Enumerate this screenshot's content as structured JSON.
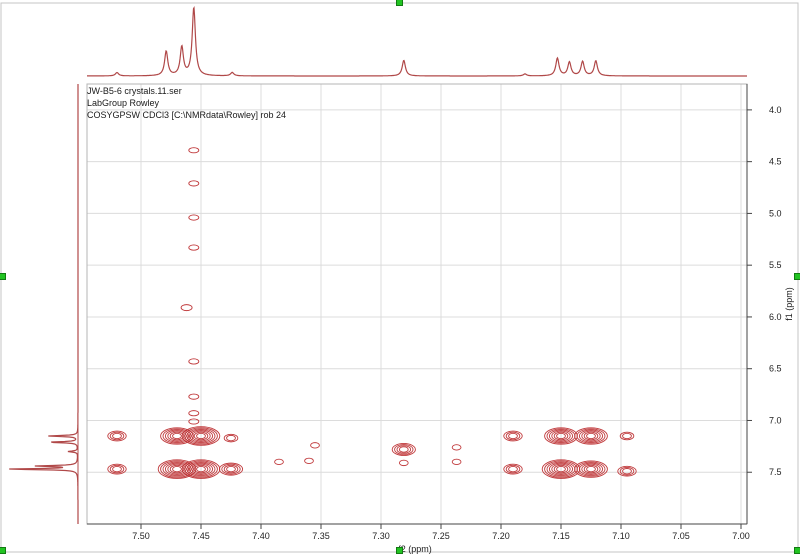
{
  "header": {
    "filename": "JW-B5-6 crystals.11.ser",
    "group": "LabGroup Rowley",
    "experiment": "COSYGPSW CDCl3 [C:\\NMRdata\\Rowley] rob 24"
  },
  "colors": {
    "contour": "#c0393b",
    "trace": "#b04848",
    "grid": "#dcdcdc",
    "axis": "#444444",
    "handle": "#22c322"
  },
  "chart_data": {
    "type": "contour",
    "xlabel": "f2 (ppm)",
    "ylabel": "f1 (ppm)",
    "xlim": [
      7.545,
      6.995
    ],
    "ylim": [
      3.75,
      8.0
    ],
    "x_reversed": true,
    "y_reversed": true,
    "grid": true,
    "x_ticks": [
      "7.50",
      "7.45",
      "7.40",
      "7.35",
      "7.30",
      "7.25",
      "7.20",
      "7.15",
      "7.10",
      "7.05",
      "7.00"
    ],
    "y_ticks": [
      "4.0",
      "4.5",
      "5.0",
      "5.5",
      "6.0",
      "6.5",
      "7.0",
      "7.5"
    ],
    "projection_f2_peaks": [
      {
        "ppm": 7.52,
        "intensity": 0.05
      },
      {
        "ppm": 7.479,
        "intensity": 0.36
      },
      {
        "ppm": 7.466,
        "intensity": 0.42
      },
      {
        "ppm": 7.456,
        "intensity": 1.0
      },
      {
        "ppm": 7.424,
        "intensity": 0.05
      },
      {
        "ppm": 7.281,
        "intensity": 0.23
      },
      {
        "ppm": 7.18,
        "intensity": 0.03
      },
      {
        "ppm": 7.153,
        "intensity": 0.26
      },
      {
        "ppm": 7.143,
        "intensity": 0.2
      },
      {
        "ppm": 7.132,
        "intensity": 0.21
      },
      {
        "ppm": 7.121,
        "intensity": 0.22
      }
    ],
    "projection_f1_peaks": [
      {
        "ppm": 7.15,
        "intensity": 0.42
      },
      {
        "ppm": 7.21,
        "intensity": 0.42
      },
      {
        "ppm": 7.3,
        "intensity": 0.14
      },
      {
        "ppm": 7.44,
        "intensity": 0.58
      },
      {
        "ppm": 7.47,
        "intensity": 1.0
      }
    ],
    "cross_peaks": [
      {
        "x": 7.52,
        "y": 7.15,
        "levels": 3
      },
      {
        "x": 7.52,
        "y": 7.47,
        "levels": 3
      },
      {
        "x": 7.47,
        "y": 7.15,
        "levels": 6
      },
      {
        "x": 7.47,
        "y": 7.47,
        "levels": 7
      },
      {
        "x": 7.45,
        "y": 7.15,
        "levels": 7
      },
      {
        "x": 7.45,
        "y": 7.47,
        "levels": 7
      },
      {
        "x": 7.425,
        "y": 7.47,
        "levels": 4
      },
      {
        "x": 7.425,
        "y": 7.17,
        "levels": 2
      },
      {
        "x": 7.385,
        "y": 7.4,
        "levels": 1
      },
      {
        "x": 7.36,
        "y": 7.39,
        "levels": 1
      },
      {
        "x": 7.355,
        "y": 7.24,
        "levels": 1
      },
      {
        "x": 7.281,
        "y": 7.28,
        "levels": 4
      },
      {
        "x": 7.281,
        "y": 7.41,
        "levels": 1
      },
      {
        "x": 7.237,
        "y": 7.26,
        "levels": 1
      },
      {
        "x": 7.237,
        "y": 7.4,
        "levels": 1
      },
      {
        "x": 7.19,
        "y": 7.15,
        "levels": 3
      },
      {
        "x": 7.19,
        "y": 7.47,
        "levels": 3
      },
      {
        "x": 7.15,
        "y": 7.15,
        "levels": 6
      },
      {
        "x": 7.15,
        "y": 7.47,
        "levels": 7
      },
      {
        "x": 7.125,
        "y": 7.15,
        "levels": 6
      },
      {
        "x": 7.125,
        "y": 7.47,
        "levels": 6
      },
      {
        "x": 7.095,
        "y": 7.15,
        "levels": 2
      },
      {
        "x": 7.095,
        "y": 7.49,
        "levels": 3
      }
    ],
    "t1_noise_column": {
      "x": 7.456,
      "y_values": [
        4.39,
        4.71,
        5.04,
        5.33,
        6.43,
        6.77,
        6.93,
        7.01
      ]
    },
    "t1_noise_offcolumn": [
      {
        "x": 7.462,
        "y": 5.91
      }
    ]
  }
}
